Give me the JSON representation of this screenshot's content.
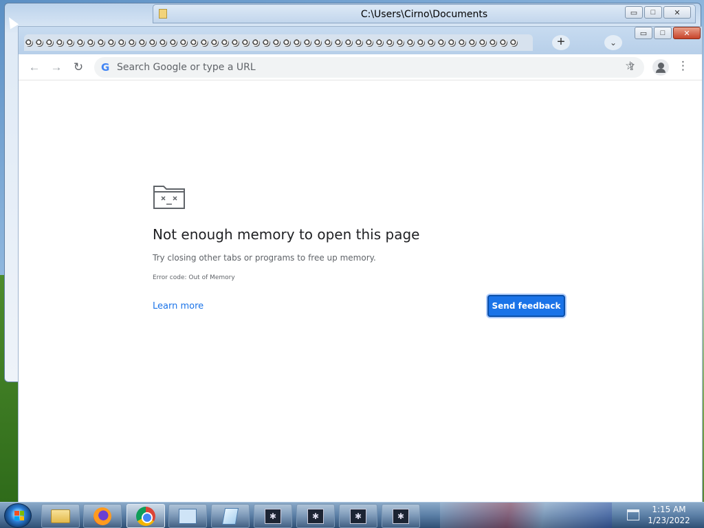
{
  "explorer_window": {
    "title": "C:\\Users\\Cirno\\Documents",
    "controls": {
      "minimize": "▭",
      "maximize": "□",
      "close": "✕"
    }
  },
  "browser": {
    "window_controls": {
      "minimize": "▭",
      "maximize": "□",
      "close": "✕"
    },
    "tab_count": 48,
    "new_tab_label": "+",
    "tab_list_label": "⌄",
    "toolbar": {
      "back_label": "←",
      "forward_label": "→",
      "reload_label": "↻",
      "omnibox_icon": "G",
      "omnibox_placeholder": "Search Google or type a URL",
      "share_label": "⇪",
      "bookmark_label": "☆",
      "menu_label": "⋮"
    },
    "error_page": {
      "icon": "sad-folder-icon",
      "title": "Not enough memory to open this page",
      "subtitle": "Try closing other tabs or programs to free up memory.",
      "error_code": "Error code: Out of Memory",
      "learn_more_label": "Learn more",
      "send_feedback_label": "Send feedback"
    }
  },
  "taskbar": {
    "items": [
      {
        "name": "windows-explorer",
        "icon": "folder-icon"
      },
      {
        "name": "firefox",
        "icon": "firefox-icon"
      },
      {
        "name": "chrome",
        "icon": "chrome-icon"
      },
      {
        "name": "control-panel",
        "icon": "control-panel-icon"
      },
      {
        "name": "notepad",
        "icon": "notepad-icon"
      },
      {
        "name": "bug-app-1",
        "icon": "bug-icon"
      },
      {
        "name": "bug-app-2",
        "icon": "bug-icon"
      },
      {
        "name": "bug-app-3",
        "icon": "bug-icon"
      },
      {
        "name": "bug-app-4",
        "icon": "bug-icon"
      }
    ],
    "clock": {
      "time": "1:15 AM",
      "date": "1/23/2022"
    }
  },
  "colors": {
    "accent": "#1a73e8",
    "link": "#1a73e8",
    "title_text": "#202124",
    "secondary_text": "#5f6368"
  }
}
